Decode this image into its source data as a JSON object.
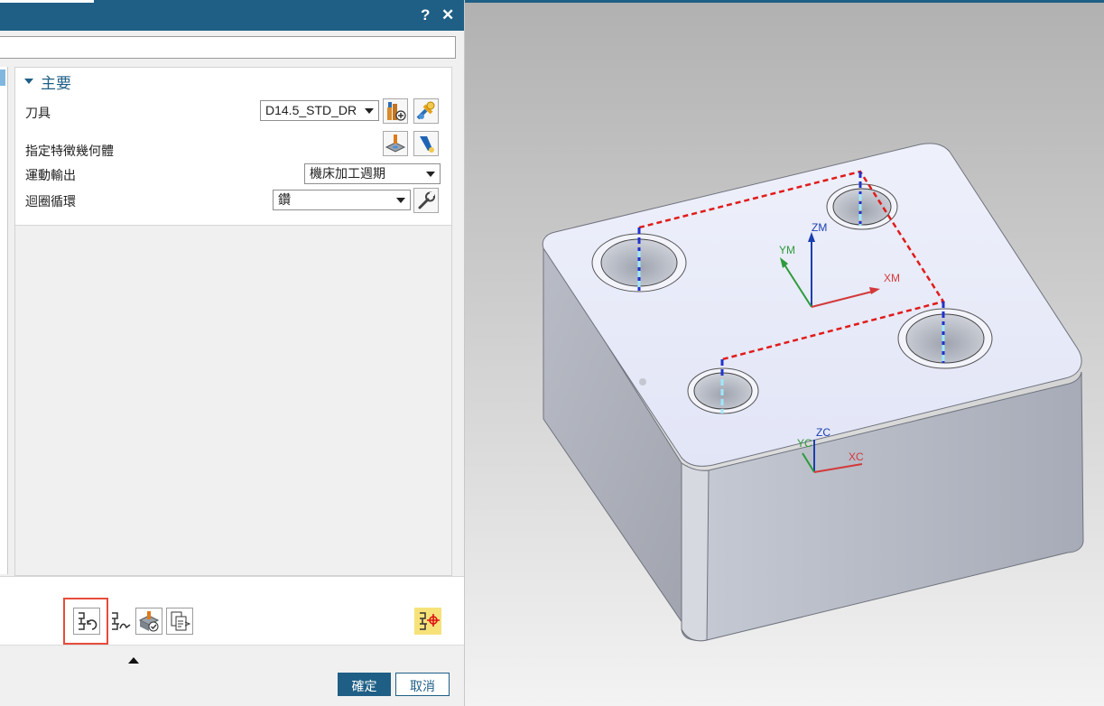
{
  "dialog": {
    "help_label": "?",
    "close_label": "✕",
    "group": {
      "title": "主要"
    },
    "rows": {
      "tool": {
        "label": "刀具",
        "value": "D14.5_STD_DR"
      },
      "feature_geometry": {
        "label": "指定特徵幾何體"
      },
      "motion_output": {
        "label": "運動輸出",
        "value": "機床加工週期"
      },
      "loop_cycle": {
        "label": "迴圈循環",
        "value": "鑽"
      }
    },
    "buttons": {
      "ok": "確定",
      "cancel": "取消"
    }
  },
  "viewport": {
    "axes": {
      "zm": "ZM",
      "ym": "YM",
      "xm": "XM",
      "zc": "ZC",
      "yc": "YC",
      "xc": "XC"
    }
  },
  "colors": {
    "titlebar": "#1f5f86",
    "accent": "#1f5f86",
    "highlight": "#e74c3c",
    "toolpath": "#e11b1b"
  },
  "icons": [
    "help-icon",
    "close-icon",
    "dropdown-arrow-icon",
    "new-tool-icon",
    "edit-tool-icon",
    "specify-feature-icon",
    "display-feature-icon",
    "edit-cycle-icon",
    "generate-icon",
    "replay-icon",
    "verify-icon",
    "list-icon",
    "postprocess-icon",
    "expand-up-icon"
  ]
}
